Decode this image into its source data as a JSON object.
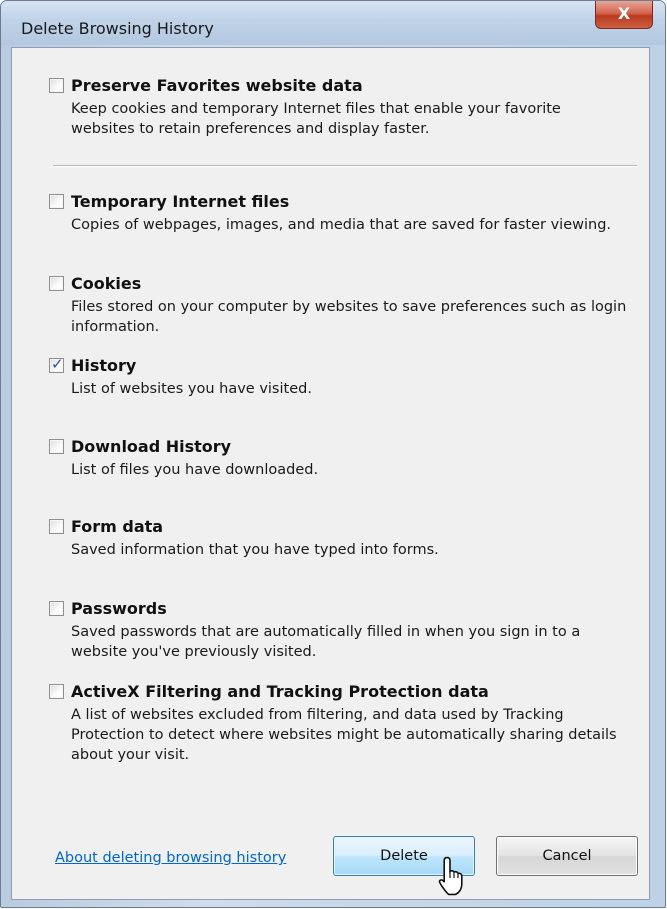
{
  "window": {
    "title": "Delete Browsing History",
    "close_glyph": "X"
  },
  "options": [
    {
      "label": "Preserve Favorites website data",
      "description": "Keep cookies and temporary Internet files that enable your favorite websites to retain preferences and display faster.",
      "checked": false
    },
    {
      "label": "Temporary Internet files",
      "description": "Copies of webpages, images, and media that are saved for faster viewing.",
      "checked": false
    },
    {
      "label": "Cookies",
      "description": "Files stored on your computer by websites to save preferences such as login information.",
      "checked": false
    },
    {
      "label": "History",
      "description": "List of websites you have visited.",
      "checked": true
    },
    {
      "label": "Download History",
      "description": "List of files you have downloaded.",
      "checked": false
    },
    {
      "label": "Form data",
      "description": "Saved information that you have typed into forms.",
      "checked": false
    },
    {
      "label": "Passwords",
      "description": "Saved passwords that are automatically filled in when you sign in to a website you've previously visited.",
      "checked": false
    },
    {
      "label": "ActiveX Filtering and Tracking Protection data",
      "description": "A list of websites excluded from filtering, and data used by Tracking Protection to detect where websites might be automatically sharing details about your visit.",
      "checked": false
    }
  ],
  "footer": {
    "help_link": "About deleting browsing history",
    "delete_label": "Delete",
    "cancel_label": "Cancel"
  },
  "check_glyph": "✓",
  "colors": {
    "link": "#0066cc",
    "close_button": "#c8452c",
    "check": "#2b4fa8"
  }
}
